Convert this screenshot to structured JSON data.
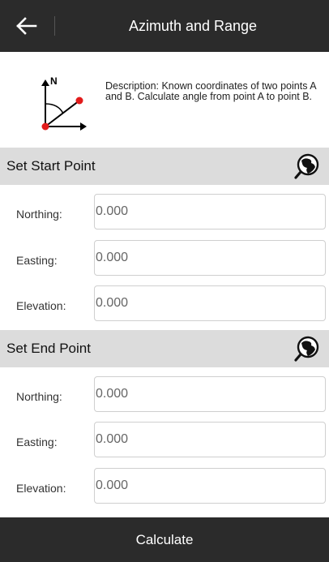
{
  "header": {
    "title": "Azimuth and Range",
    "back_icon": "arrow-left-icon"
  },
  "description": {
    "icon": "azimuth-diagram-icon",
    "north_label": "N",
    "text": "Description: Known coordinates of two points A and B. Calculate angle from point A to point B."
  },
  "start_point": {
    "title": "Set Start Point",
    "picker_icon": "globe-search-icon",
    "fields": [
      {
        "label": "Northing:",
        "value": "0.000"
      },
      {
        "label": "Easting:",
        "value": "0.000"
      },
      {
        "label": "Elevation:",
        "value": "0.000"
      }
    ]
  },
  "end_point": {
    "title": "Set End Point",
    "picker_icon": "globe-search-icon",
    "fields": [
      {
        "label": "Northing:",
        "value": "0.000"
      },
      {
        "label": "Easting:",
        "value": "0.000"
      },
      {
        "label": "Elevation:",
        "value": "0.000"
      }
    ]
  },
  "actions": {
    "calculate_label": "Calculate"
  },
  "colors": {
    "bar": "#2b2b2b",
    "section_bg": "#dcdcdc",
    "point": "#e21b1b"
  }
}
